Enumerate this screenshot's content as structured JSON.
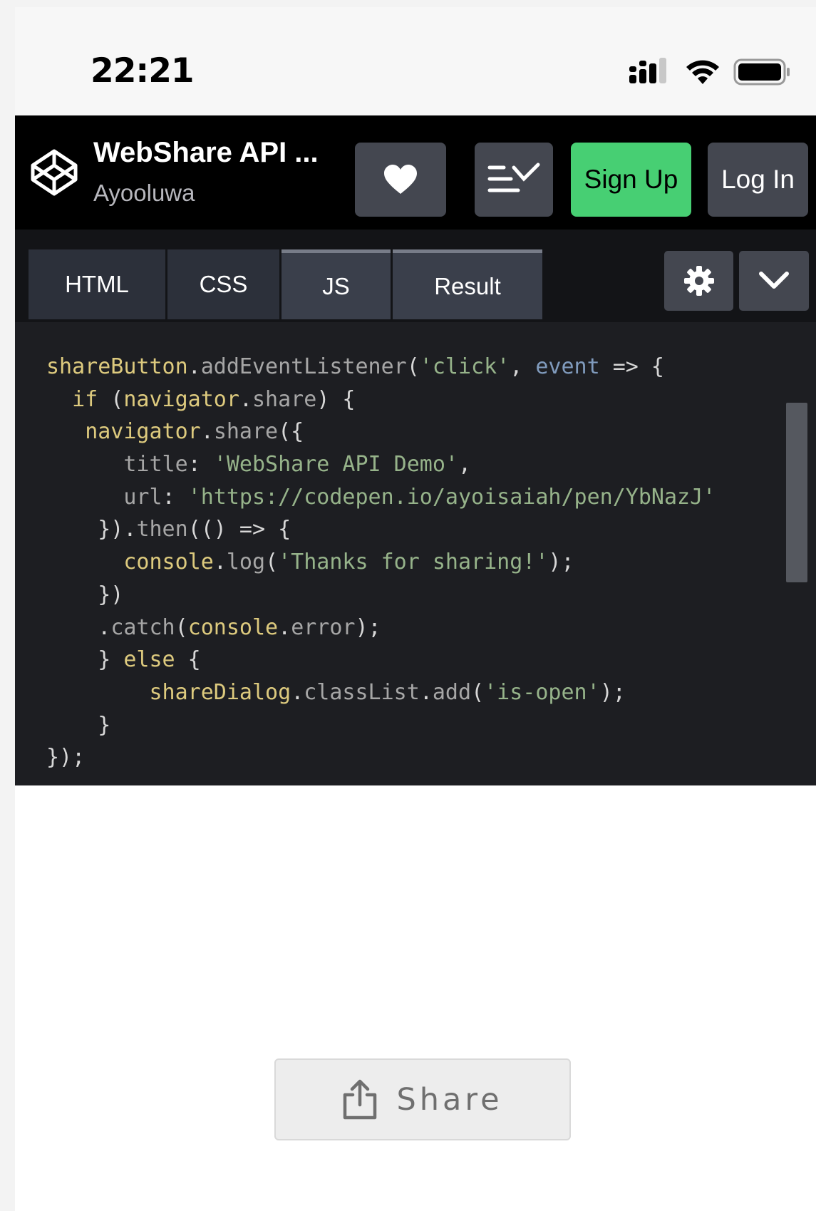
{
  "status_bar": {
    "time": "22:21"
  },
  "header": {
    "pen_title": "WebShare API ...",
    "author": "Ayooluwa",
    "signup_label": "Sign Up",
    "login_label": "Log In",
    "colors": {
      "signup": "#47cf73",
      "bar": "#000000",
      "button": "#444750"
    }
  },
  "tabs": [
    {
      "label": "HTML"
    },
    {
      "label": "CSS"
    },
    {
      "label": "JS"
    },
    {
      "label": "Result"
    }
  ],
  "code_lines": [
    [
      [
        "var",
        "shareButton"
      ],
      [
        "punc",
        "."
      ],
      [
        "prop",
        "addEventListener"
      ],
      [
        "punc",
        "("
      ],
      [
        "str",
        "'click'"
      ],
      [
        "punc",
        ", "
      ],
      [
        "param",
        "event"
      ],
      [
        "punc",
        " => {"
      ]
    ],
    [
      [
        "punc",
        "  "
      ],
      [
        "kw",
        "if"
      ],
      [
        "punc",
        " ("
      ],
      [
        "var",
        "navigator"
      ],
      [
        "punc",
        "."
      ],
      [
        "prop",
        "share"
      ],
      [
        "punc",
        ") {"
      ]
    ],
    [
      [
        "punc",
        "   "
      ],
      [
        "var",
        "navigator"
      ],
      [
        "punc",
        "."
      ],
      [
        "prop",
        "share"
      ],
      [
        "punc",
        "({"
      ]
    ],
    [
      [
        "punc",
        "      "
      ],
      [
        "prop",
        "title"
      ],
      [
        "punc",
        ": "
      ],
      [
        "str",
        "'WebShare API Demo'"
      ],
      [
        "punc",
        ","
      ]
    ],
    [
      [
        "punc",
        "      "
      ],
      [
        "prop",
        "url"
      ],
      [
        "punc",
        ": "
      ],
      [
        "str",
        "'https://codepen.io/ayoisaiah/pen/YbNazJ'"
      ]
    ],
    [
      [
        "punc",
        "    })."
      ],
      [
        "prop",
        "then"
      ],
      [
        "punc",
        "(() => {"
      ]
    ],
    [
      [
        "punc",
        "      "
      ],
      [
        "var",
        "console"
      ],
      [
        "punc",
        "."
      ],
      [
        "prop",
        "log"
      ],
      [
        "punc",
        "("
      ],
      [
        "str",
        "'Thanks for sharing!'"
      ],
      [
        "punc",
        ");"
      ]
    ],
    [
      [
        "punc",
        "    })"
      ]
    ],
    [
      [
        "punc",
        "    ."
      ],
      [
        "prop",
        "catch"
      ],
      [
        "punc",
        "("
      ],
      [
        "var",
        "console"
      ],
      [
        "punc",
        "."
      ],
      [
        "prop",
        "error"
      ],
      [
        "punc",
        ");"
      ]
    ],
    [
      [
        "punc",
        "    } "
      ],
      [
        "kw",
        "else"
      ],
      [
        "punc",
        " {"
      ]
    ],
    [
      [
        "punc",
        "        "
      ],
      [
        "var",
        "shareDialog"
      ],
      [
        "punc",
        "."
      ],
      [
        "prop",
        "classList"
      ],
      [
        "punc",
        "."
      ],
      [
        "prop",
        "add"
      ],
      [
        "punc",
        "("
      ],
      [
        "str",
        "'is-open'"
      ],
      [
        "punc",
        ");"
      ]
    ],
    [
      [
        "punc",
        "    }"
      ]
    ],
    [
      [
        "punc",
        "});"
      ]
    ]
  ],
  "result": {
    "share_label": "Share"
  },
  "icons": {
    "logo": "codepen-logo-icon",
    "heart": "heart-icon",
    "layout": "layout-toggle-icon",
    "settings": "gear-icon",
    "collapse": "chevron-down-icon",
    "share": "share-icon",
    "signal": "signal-icon",
    "wifi": "wifi-icon",
    "battery": "battery-icon"
  }
}
